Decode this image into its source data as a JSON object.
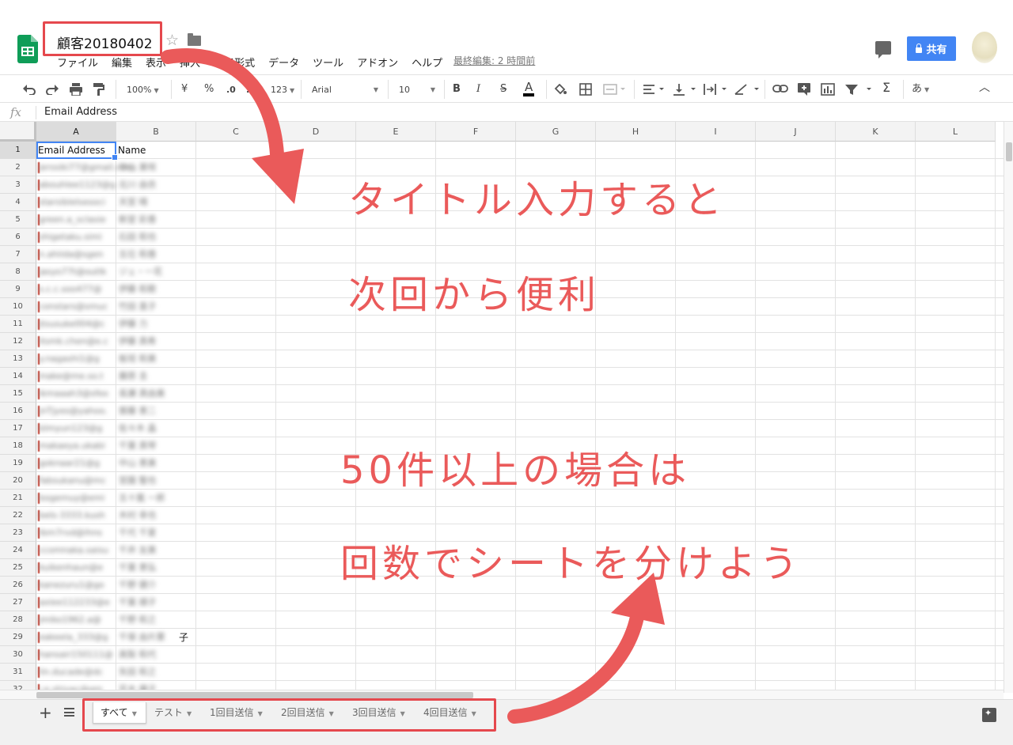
{
  "document": {
    "title": "顧客20180402",
    "last_edit": "最終編集: 2 時間前"
  },
  "menu": [
    "ファイル",
    "編集",
    "表示",
    "挿入",
    "表示形式",
    "データ",
    "ツール",
    "アドオン",
    "ヘルプ"
  ],
  "share": {
    "label": "共有"
  },
  "toolbar": {
    "zoom": "100%",
    "currency": "¥",
    "percent": "%",
    "decimal_dec": ".0",
    "decimal_inc": ".00",
    "more_formats": "123",
    "font": "Arial",
    "font_size": "10",
    "bold": "B",
    "italic": "I",
    "strike": "S",
    "text_color": "A",
    "input_tools": "あ"
  },
  "formula_bar": {
    "fx_label": "fx",
    "value": "Email Address"
  },
  "columns": [
    "A",
    "B",
    "C",
    "D",
    "E",
    "F",
    "G",
    "H",
    "I",
    "J",
    "K",
    "L"
  ],
  "rows": [
    "1",
    "2",
    "3",
    "4",
    "5",
    "6",
    "7",
    "8",
    "9",
    "10",
    "11",
    "12",
    "13",
    "14",
    "15",
    "16",
    "17",
    "18",
    "19",
    "20",
    "21",
    "22",
    "23",
    "24",
    "25",
    "26",
    "27",
    "28",
    "29",
    "30",
    "31",
    "32"
  ],
  "header_row": {
    "a": "Email Address",
    "b": "Name"
  },
  "cells": {
    "b29_tail": "子"
  },
  "blurred_rows": [
    {
      "a": "jerssiki77@gmail.com",
      "b": "中山 美咲"
    },
    {
      "a": "abouhlee1123@g",
      "b": "北川 由衣"
    },
    {
      "a": "starsiblelsesoci",
      "b": "天宮 晴"
    },
    {
      "a": "green.a_sclasie",
      "b": "新堂 彩香"
    },
    {
      "a": "shigetaku.simi",
      "b": "石田 和也"
    },
    {
      "a": "n.ahiida@sgen",
      "b": "五位 和香"
    },
    {
      "a": "jasyo77t@outlk",
      "b": "ジェ・一花"
    },
    {
      "a": "s.c.c.soo477@",
      "b": "伊藤 和歌"
    },
    {
      "a": "constars@smuc",
      "b": "竹田 直子"
    },
    {
      "a": "jtsusuke004@c",
      "b": "伊藤 力"
    },
    {
      "a": "itsmk.chen@e.c",
      "b": "伊藤 真希"
    },
    {
      "a": "y.nagashi1@g",
      "b": "板垣 和美"
    },
    {
      "a": "inake@me.so.t",
      "b": "藤原 圭"
    },
    {
      "a": "ikmaaah3@sfex",
      "b": "長瀬 真由美"
    },
    {
      "a": "jnTjyes@yahoo.",
      "b": "齋藤 恵二"
    },
    {
      "a": "blmyun123@g",
      "b": "佐々木 晶"
    },
    {
      "a": "makaeya.ukabi",
      "b": "千葉 真琴"
    },
    {
      "a": "goknaar21@g",
      "b": "中山 恵美"
    },
    {
      "a": "fabsukanu@mc",
      "b": "宮園 聖也"
    },
    {
      "a": "bogemuy@emi",
      "b": "五十嵐 一郎"
    },
    {
      "a": "bels-3333.kush",
      "b": "木村 幸也"
    },
    {
      "a": "tkm7rvd@ihns",
      "b": "千代 千夏"
    },
    {
      "a": "ccomnaka.saisu",
      "b": "千井 友美"
    },
    {
      "a": "kuikenhaun@e",
      "b": "千葉 恵弘"
    },
    {
      "a": "kanezuru1@go",
      "b": "千野 健介"
    },
    {
      "a": "axiee112233@e",
      "b": "千葉 順子"
    },
    {
      "a": "jmiko1962.a@",
      "b": "千野 和之"
    },
    {
      "a": "eakeela_333@g",
      "b": "千保 由片栗"
    },
    {
      "a": "hansair150111@",
      "b": "高梨 和代"
    },
    {
      "a": "lin.ducade@dc",
      "b": "矢田 和之"
    },
    {
      "a": "j.e.shivac@gm",
      "b": "花木 優子"
    }
  ],
  "sheet_tabs": [
    "すべて",
    "テスト",
    "1回目送信",
    "2回目送信",
    "3回目送信",
    "4回目送信"
  ],
  "annotations": {
    "line1": "タイトル入力すると",
    "line2": "次回から便利",
    "line3": "50件以上の場合は",
    "line4": "回数でシートを分けよう"
  },
  "colors": {
    "annotation": "#ea5a5a",
    "share": "#4285f4",
    "selection": "#4285f4",
    "sheets_green": "#0f9d58"
  },
  "icons": [
    "sheets-logo-icon",
    "star-icon",
    "folder-icon",
    "comment-icon",
    "lock-icon",
    "undo-icon",
    "redo-icon",
    "print-icon",
    "paint-format-icon",
    "fill-color-icon",
    "borders-icon",
    "merge-icon",
    "align-icon",
    "valign-icon",
    "wrap-icon",
    "rotate-icon",
    "link-icon",
    "comment-add-icon",
    "chart-icon",
    "filter-icon",
    "function-icon",
    "collapse-icon",
    "add-sheet-icon",
    "all-sheets-icon",
    "explore-icon",
    "arrow-icon"
  ]
}
